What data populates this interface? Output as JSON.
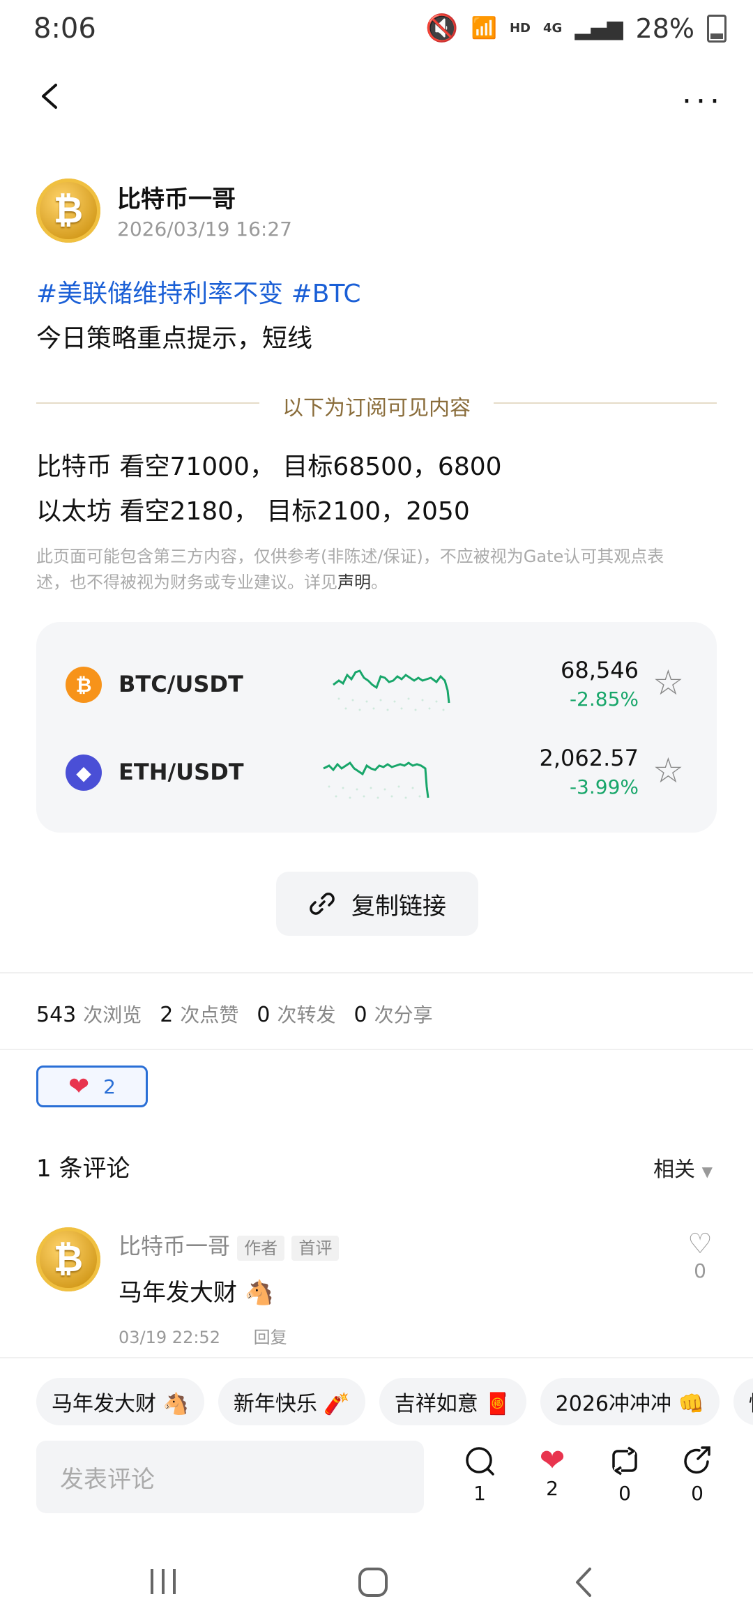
{
  "status_bar": {
    "time": "8:06",
    "battery": "28%",
    "network": "4G",
    "hd": "HD"
  },
  "post": {
    "author": "比特币一哥",
    "time": "2026/03/19 16:27",
    "hashtags": "#美联储维持利率不变 #BTC",
    "text": "今日策略重点提示，短线",
    "subscriber_divider": "以下为订阅可见内容",
    "strategy_lines": [
      "比特币 看空71000， 目标68500，6800",
      "以太坊 看空2180， 目标2100，2050"
    ],
    "disclaimer": "此页面可能包含第三方内容，仅供参考(非陈述/保证)，不应被视为Gate认可其观点表述，也不得被视为财务或专业建议。详见",
    "disclaimer_link": "声明",
    "disclaimer_end": "。"
  },
  "markets": [
    {
      "pair": "BTC/USDT",
      "price": "68,546",
      "change": "-2.85%",
      "icon": "bitcoin-icon",
      "color": "#f7931a",
      "glyph": "₿"
    },
    {
      "pair": "ETH/USDT",
      "price": "2,062.57",
      "change": "-3.99%",
      "icon": "ethereum-icon",
      "color": "#4a4fd6",
      "glyph": "◆"
    }
  ],
  "copy_link": "复制链接",
  "stats": {
    "views": "543",
    "views_label": "次浏览",
    "likes": "2",
    "likes_label": "次点赞",
    "reposts": "0",
    "reposts_label": "次转发",
    "shares": "0",
    "shares_label": "次分享"
  },
  "reaction": {
    "count": "2"
  },
  "comments": {
    "title": "1 条评论",
    "sort": "相关",
    "items": [
      {
        "author": "比特币一哥",
        "tag_author": "作者",
        "tag_first": "首评",
        "text": "马年发大财 🐴",
        "time": "03/19 22:52",
        "reply": "回复",
        "likes": "0"
      }
    ]
  },
  "quick_replies": [
    "马年发大财 🐴",
    "新年快乐 🧨",
    "吉祥如意 🧧",
    "2026冲冲冲 👊",
    "快"
  ],
  "bottom": {
    "placeholder": "发表评论",
    "comment_count": "1",
    "like_count": "2",
    "repost_count": "0",
    "share_count": "0"
  },
  "colors": {
    "accent": "#1a5fd6",
    "down": "#18a66a",
    "gold": "#8a6d3b"
  }
}
